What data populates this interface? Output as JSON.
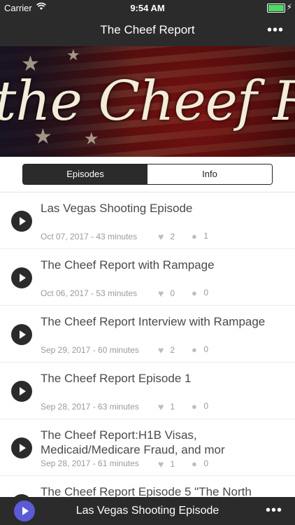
{
  "status_bar": {
    "carrier": "Carrier",
    "time": "9:54 AM"
  },
  "nav": {
    "title": "The Cheef Report",
    "more_icon": "•••"
  },
  "banner": {
    "script_text": "the Cheef Repo"
  },
  "tabs": [
    {
      "label": "Episodes",
      "active": true
    },
    {
      "label": "Info",
      "active": false
    }
  ],
  "episodes": [
    {
      "title": "Las Vegas Shooting Episode",
      "meta": "Oct 07, 2017 - 43 minutes",
      "likes": "2",
      "comments": "1"
    },
    {
      "title": "The Cheef Report with Rampage",
      "meta": "Oct 06, 2017 - 53 minutes",
      "likes": "0",
      "comments": "0"
    },
    {
      "title": "The Cheef Report Interview with Rampage",
      "meta": "Sep 29, 2017 - 60 minutes",
      "likes": "2",
      "comments": "0"
    },
    {
      "title": "The Cheef Report Episode 1",
      "meta": "Sep 28, 2017 - 63 minutes",
      "likes": "1",
      "comments": "0"
    },
    {
      "title": "The Cheef Report:H1B Visas, Medicaid/Medicare Fraud, and mor",
      "meta": "Sep 28, 2017 - 61 minutes",
      "likes": "1",
      "comments": "0"
    },
    {
      "title": "The Cheef Report Episode 5 \"The North",
      "meta": "",
      "likes": "",
      "comments": ""
    }
  ],
  "player": {
    "now_playing": "Las Vegas Shooting Episode",
    "more_icon": "•••"
  },
  "colors": {
    "bar": "#2b2b2b",
    "player_button": "#5b5bd6",
    "battery": "#4cd964"
  }
}
